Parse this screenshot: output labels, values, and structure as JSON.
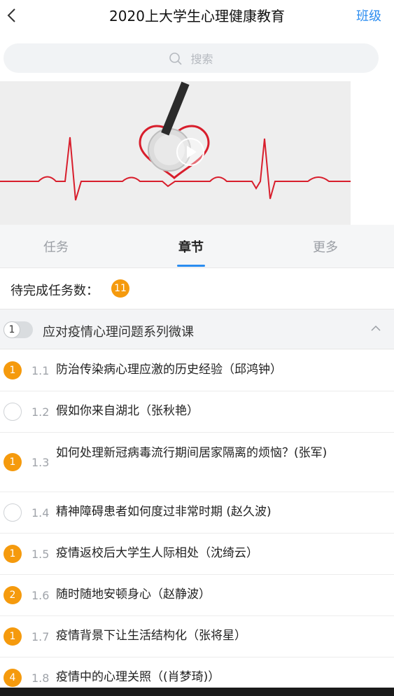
{
  "header": {
    "title": "2020上大学生心理健康教育",
    "class_link": "班级",
    "back_icon": "chevron-left-icon"
  },
  "search": {
    "placeholder": "搜索",
    "icon": "search-icon"
  },
  "banner": {
    "play_icon": "play-icon"
  },
  "tabs": [
    {
      "label": "任务"
    },
    {
      "label": "章节",
      "active": true
    },
    {
      "label": "更多"
    }
  ],
  "pending": {
    "label": "待完成任务数：",
    "count": "11"
  },
  "section": {
    "index": "1",
    "title": "应对疫情心理问题系列微课",
    "collapse_icon": "chevron-up-icon"
  },
  "lessons": [
    {
      "status": "1",
      "num": "1.1",
      "title": "防治传染病心理应激的历史经验（邱鸿钟）"
    },
    {
      "status": "",
      "num": "1.2",
      "title": "假如你来自湖北（张秋艳）"
    },
    {
      "status": "1",
      "num": "1.3",
      "title": "如何处理新冠病毒流行期间居家隔离的烦恼？(张军)"
    },
    {
      "status": "",
      "num": "1.4",
      "title": "精神障碍患者如何度过非常时期 (赵久波)"
    },
    {
      "status": "1",
      "num": "1.5",
      "title": "疫情返校后大学生人际相处（沈绮云）"
    },
    {
      "status": "2",
      "num": "1.6",
      "title": "随时随地安顿身心（赵静波）"
    },
    {
      "status": "1",
      "num": "1.7",
      "title": "疫情背景下让生活结构化（张将星）"
    },
    {
      "status": "4",
      "num": "1.8",
      "title": "疫情中的心理关照（(肖梦琦)）"
    }
  ],
  "colors": {
    "accent": "#2a8cf0",
    "badge": "#f59a0d",
    "ecg_line": "#d81e2c"
  }
}
